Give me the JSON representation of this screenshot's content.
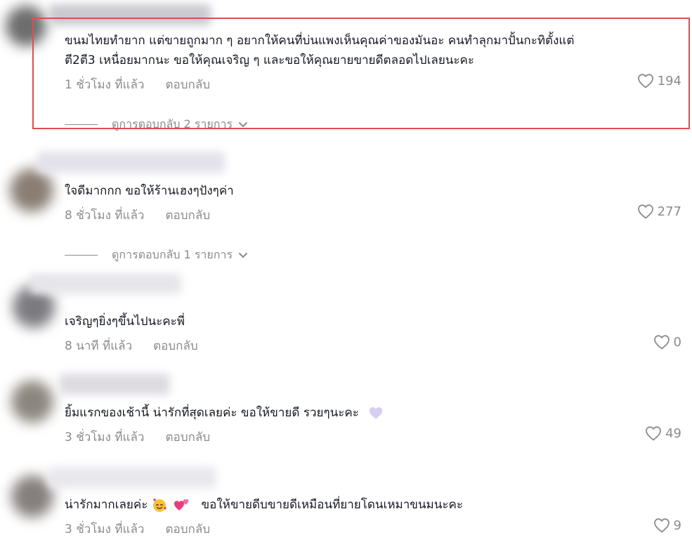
{
  "comments": [
    {
      "text_line1": "ขนมไทยทำยาก แต่ขายถูกมาก ๆ อยากให้คนที่บ่นแพงเห็นคุณค่าของมันอะ คนทำลุกมาปั้นกะทิตั้งแต่",
      "text_line2": "ตี2ตี3 เหนื่อยมากนะ ขอให้คุณเจริญ ๆ และขอให้คุณยายขายดีตลอดไปเลยนะคะ",
      "time": "1 ชั่วโมง ที่แล้ว",
      "reply_label": "ตอบกลับ",
      "likes": "194",
      "view_replies": "ดูการตอบกลับ 2 รายการ",
      "highlighted": true
    },
    {
      "text": "ใจดีมากกก ขอให้ร้านเฮงๆปังๆค่า",
      "time": "8 ชั่วโมง ที่แล้ว",
      "reply_label": "ตอบกลับ",
      "likes": "277",
      "view_replies": "ดูการตอบกลับ 1 รายการ"
    },
    {
      "text": "เจริญๆยิ่งๆขึ้นไปนะคะพี่",
      "time": "8 นาที ที่แล้ว",
      "reply_label": "ตอบกลับ",
      "likes": "0"
    },
    {
      "text": "ยิ้มแรกของเช้านี้ น่ารักที่สุดเลยค่ะ ขอให้ขายดี รวยๆนะคะ",
      "emoji_after": "purple-heart",
      "time": "3 ชั่วโมง ที่แล้ว",
      "reply_label": "ตอบกลับ",
      "likes": "49"
    },
    {
      "text_before": "น่ารักมากเลยค่ะ",
      "emojis": [
        "smiling-face-with-hearts",
        "two-hearts"
      ],
      "text_after": "ขอให้ขายดีบขายดีเหมือนที่ยายโดนเหมาขนมนะคะ",
      "time": "3 ชั่วโมง ที่แล้ว",
      "reply_label": "ตอบกลับ",
      "likes": "9"
    }
  ],
  "colors": {
    "text": "#161823",
    "muted": "#8a8b91",
    "highlight_border": "#e24b4b"
  },
  "icons": {
    "like": "heart-outline-icon",
    "expand": "chevron-down-icon"
  }
}
